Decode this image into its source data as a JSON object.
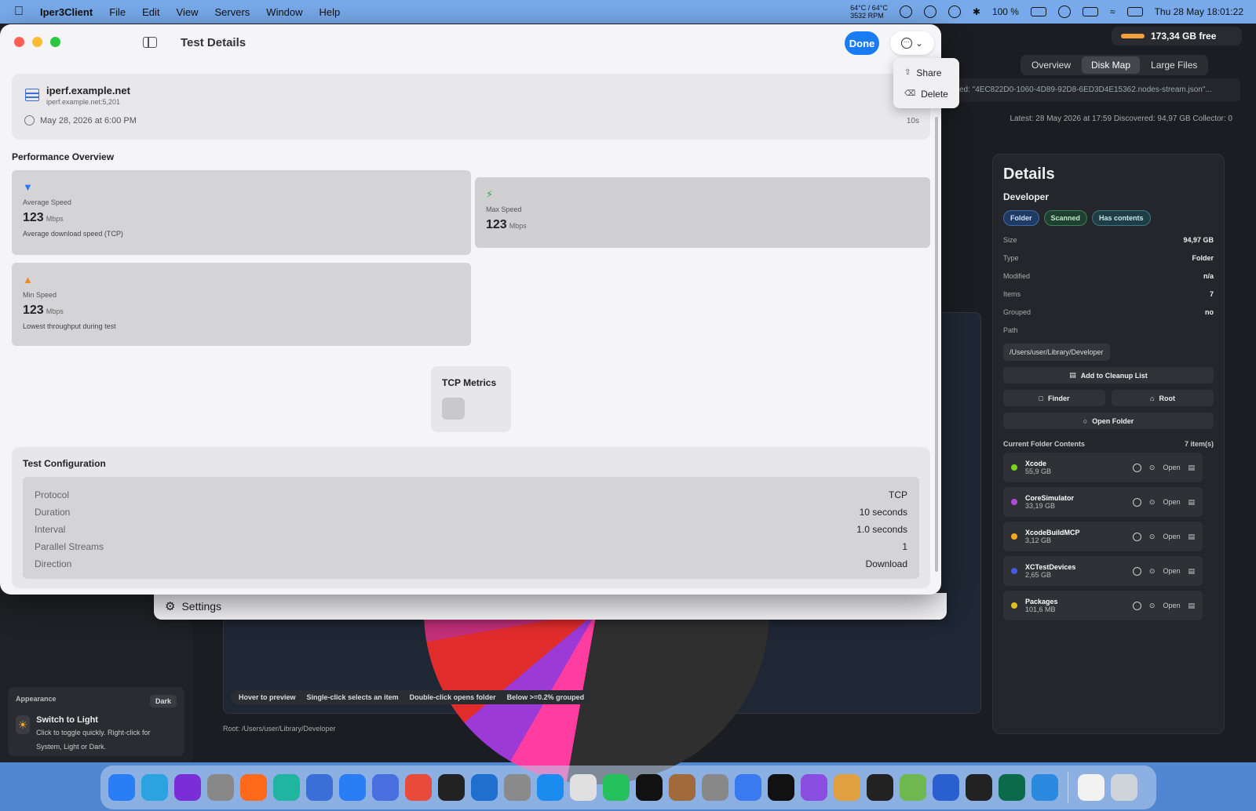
{
  "menubar": {
    "app_name": "Iper3Client",
    "menus": [
      "File",
      "Edit",
      "View",
      "Servers",
      "Window",
      "Help"
    ],
    "temp_line1": "64°C / 64°C",
    "temp_line2": "3532 RPM",
    "battery": "100 %",
    "clock": "Thu 28 May  18:01:22"
  },
  "background_app": {
    "disk_free": "173,34 GB free",
    "tabs": [
      "Overview",
      "Disk Map",
      "Large Files"
    ],
    "selected_tab": "Disk Map",
    "path_text": "ed: \"4EC822D0-1060-4D89-92D8-6ED3D4E15362.nodes-stream.json\"...",
    "status_line": "Latest: 28 May 2026 at 17:59   Discovered: 94,97 GB   Collector: 0",
    "details": {
      "title": "Details",
      "name": "Developer",
      "tags": [
        "Folder",
        "Scanned",
        "Has contents"
      ],
      "rows": [
        {
          "k": "Size",
          "v": "94,97 GB"
        },
        {
          "k": "Type",
          "v": "Folder"
        },
        {
          "k": "Modified",
          "v": "n/a"
        },
        {
          "k": "Items",
          "v": "7"
        },
        {
          "k": "Grouped",
          "v": "no"
        }
      ],
      "path_label": "Path",
      "path_value": "/Users/user/Library/Developer",
      "add_cleanup": "Add to Cleanup List",
      "finder": "Finder",
      "root": "Root",
      "open_folder": "Open Folder",
      "contents_label": "Current Folder Contents",
      "contents_count": "7 item(s)",
      "open_label": "Open",
      "items": [
        {
          "name": "Xcode",
          "size": "55,9 GB",
          "color": "#7ed321"
        },
        {
          "name": "CoreSimulator",
          "size": "33,19 GB",
          "color": "#b04ad8"
        },
        {
          "name": "XcodeBuildMCP",
          "size": "3,12 GB",
          "color": "#f5a623"
        },
        {
          "name": "XCTestDevices",
          "size": "2,65 GB",
          "color": "#4a5ae0"
        },
        {
          "name": "Packages",
          "size": "101,6 MB",
          "color": "#e0c020"
        }
      ]
    },
    "hover_hints": [
      "Hover to preview",
      "Single-click selects an item",
      "Double-click opens folder",
      "Below >=0.2% grouped"
    ],
    "root_line": "Root: /Users/user/Library/Developer",
    "appearance": {
      "label": "Appearance",
      "mode": "Dark",
      "switch_title": "Switch to Light",
      "switch_desc": "Click to toggle quickly. Right-click for System, Light or Dark."
    },
    "settings_label": "Settings"
  },
  "sheet": {
    "title": "Test Details",
    "done_label": "Done",
    "more_menu": {
      "share": "Share",
      "delete": "Delete"
    },
    "server": {
      "name": "iperf.example.net",
      "host": "iperf.example.net:5,201",
      "date": "May 28, 2026 at 6:00 PM",
      "duration": "10s"
    },
    "performance_title": "Performance Overview",
    "metrics": {
      "avg": {
        "label": "Average Speed",
        "value": "123",
        "unit": "Mbps",
        "desc": "Average download speed (TCP)"
      },
      "max": {
        "label": "Max Speed",
        "value": "123",
        "unit": "Mbps"
      },
      "min": {
        "label": "Min Speed",
        "value": "123",
        "unit": "Mbps",
        "desc": "Lowest throughput during test"
      }
    },
    "tcp_title": "TCP Metrics",
    "config": {
      "title": "Test Configuration",
      "rows": [
        {
          "k": "Protocol",
          "v": "TCP"
        },
        {
          "k": "Duration",
          "v": "10 seconds"
        },
        {
          "k": "Interval",
          "v": "1.0 seconds"
        },
        {
          "k": "Parallel Streams",
          "v": "1"
        },
        {
          "k": "Direction",
          "v": "Download"
        }
      ]
    }
  },
  "dock_icons": [
    "finder-icon",
    "telegram-icon",
    "phpstorm-icon",
    "unknown-icon",
    "firefox-icon",
    "webstorm-icon",
    "editor-icon",
    "appstore-dev-icon",
    "messenger-icon",
    "chrome-icon",
    "prompt-icon",
    "airmail-icon",
    "settings-icon",
    "appstore-icon",
    "launchpad-icon",
    "whatsapp-icon",
    "chatgpt-icon",
    "bear-icon",
    "unknown-icon",
    "spark-icon",
    "perplexity-icon",
    "nova-icon",
    "dog-icon",
    "terminal-icon",
    "editor2-icon",
    "xcode-icon",
    "activity-icon",
    "network-icon",
    "waveform-icon",
    "document-icon",
    "trash-icon"
  ]
}
